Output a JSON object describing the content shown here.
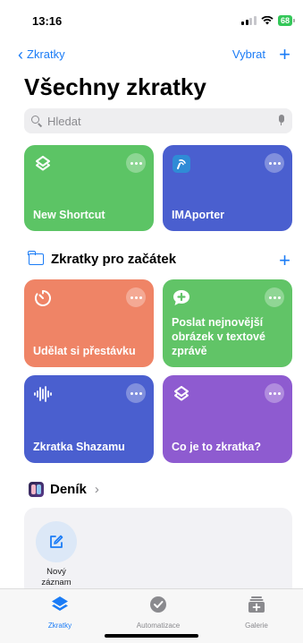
{
  "status": {
    "time": "13:16",
    "battery": "68"
  },
  "nav": {
    "back_label": "Zkratky",
    "select_label": "Vybrat",
    "add_label": "+"
  },
  "page_title": "Všechny zkratky",
  "search": {
    "placeholder": "Hledat"
  },
  "my_shortcuts": [
    {
      "label": "New Shortcut",
      "color": "#5cc465",
      "icon": "layers-icon"
    },
    {
      "label": "IMAporter",
      "color": "#4a5fcf",
      "icon": "nfc-icon"
    }
  ],
  "starter_section": {
    "title": "Zkratky pro začátek",
    "add_label": "+"
  },
  "starter_shortcuts": [
    {
      "label": "Udělat si přestávku",
      "color": "#ef8466",
      "icon": "timer-icon"
    },
    {
      "label": "Poslat nejnovější obrázek v textové zprávě",
      "color": "#61c467",
      "icon": "message-plus-icon"
    },
    {
      "label": "Zkratka Shazamu",
      "color": "#4a5fcf",
      "icon": "waveform-icon"
    },
    {
      "label": "Co je to zkratka?",
      "color": "#8e5bd0",
      "icon": "layers-icon"
    }
  ],
  "journal": {
    "title": "Deník",
    "chevron": "›",
    "new_entry_label": "Nový záznam"
  },
  "tabbar": {
    "items": [
      {
        "label": "Zkratky",
        "active": true,
        "icon": "shortcuts-icon"
      },
      {
        "label": "Automatizace",
        "active": false,
        "icon": "clock-check-icon"
      },
      {
        "label": "Galerie",
        "active": false,
        "icon": "gallery-plus-icon"
      }
    ]
  },
  "colors": {
    "accent": "#1b7cf6",
    "inactive": "#8a8a8e"
  }
}
